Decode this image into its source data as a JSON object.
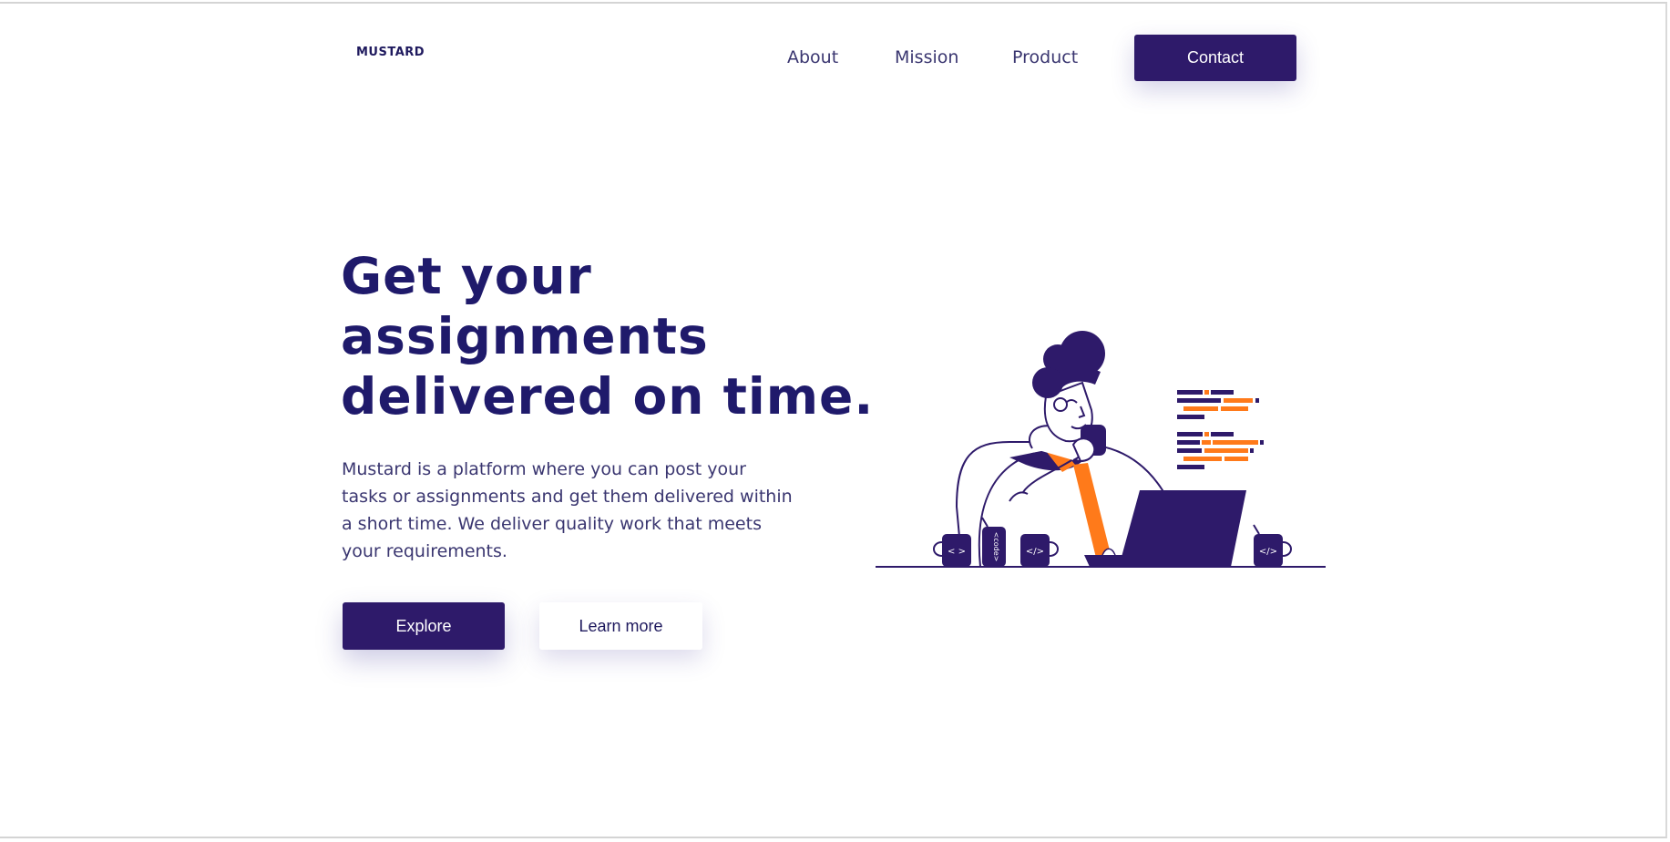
{
  "brand": {
    "logo_text": "MUSTARD"
  },
  "nav": {
    "items": [
      {
        "label": "About"
      },
      {
        "label": "Mission"
      },
      {
        "label": "Product"
      }
    ],
    "contact_label": "Contact"
  },
  "hero": {
    "headline_lines": [
      "Get your",
      "assignments",
      "delivered on time."
    ],
    "description_lines": [
      "Mustard is a platform where you can post your",
      "tasks or assignments and get them delivered within",
      "a short time. We deliver quality work that meets",
      "your requirements."
    ],
    "primary_button": "Explore",
    "secondary_button": "Learn more"
  },
  "illustration": {
    "mug_labels": [
      "< >",
      "</>",
      "</>"
    ],
    "can_label": "<code>"
  },
  "colors": {
    "primary": "#2e1a6a",
    "heading": "#1f1a6b",
    "text": "#3a3670",
    "accent": "#ff7a1a",
    "background": "#ffffff"
  }
}
